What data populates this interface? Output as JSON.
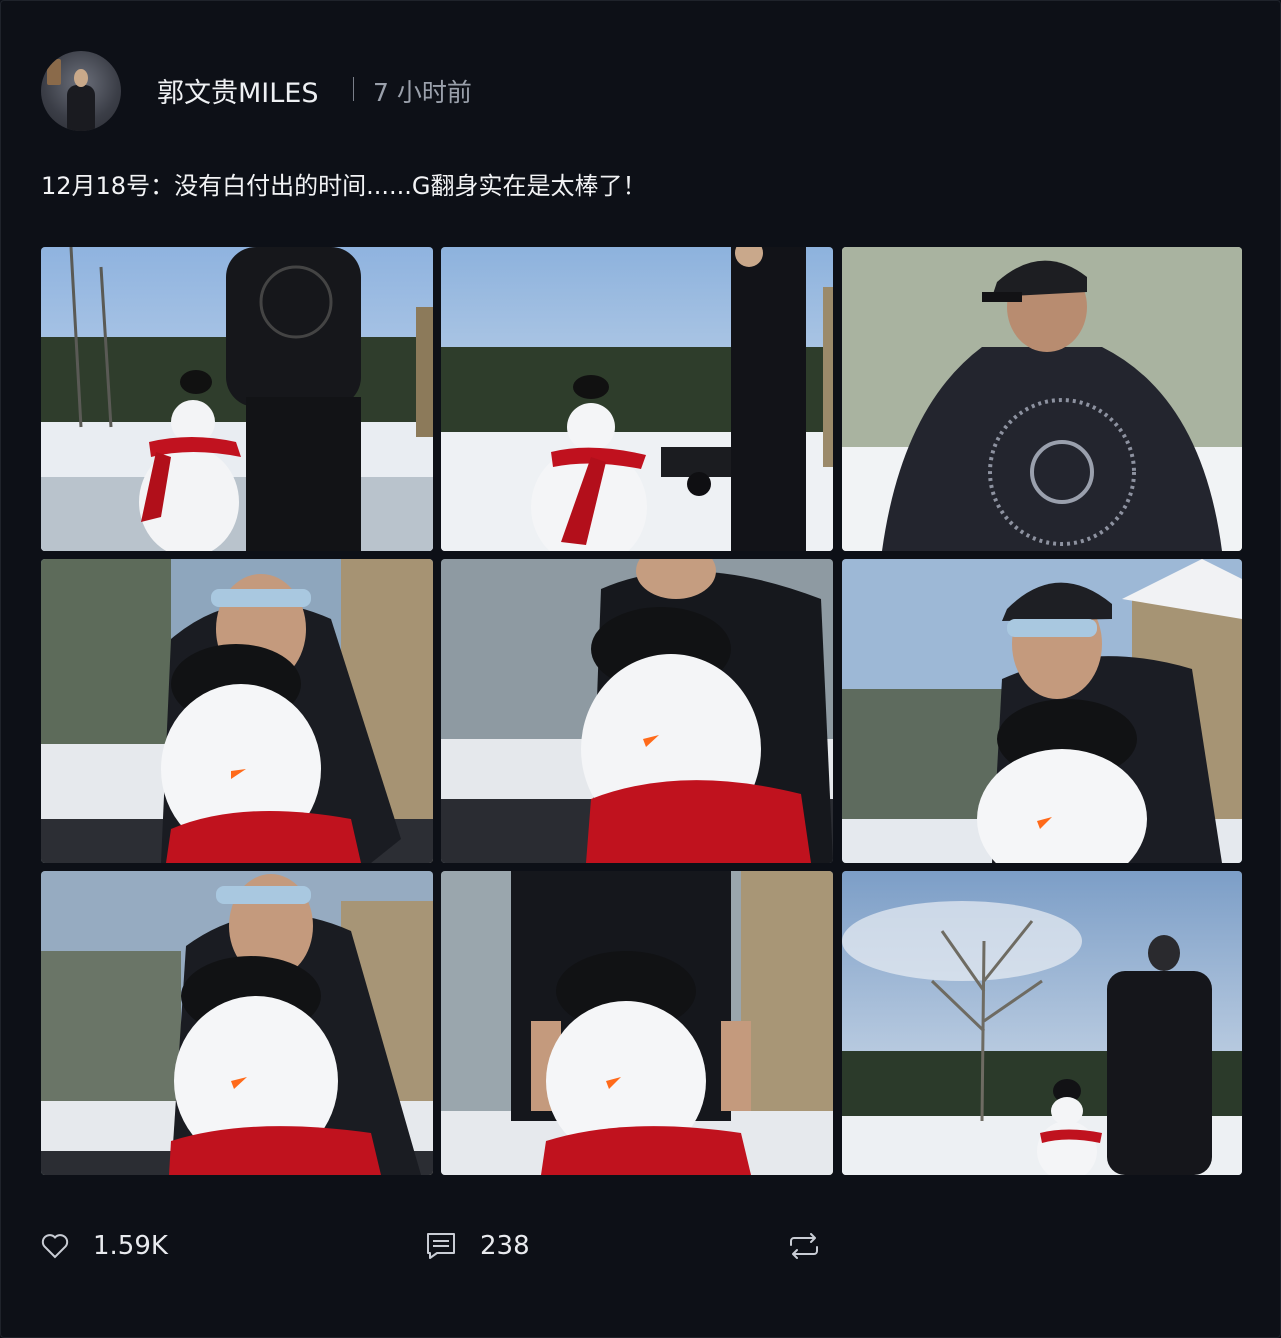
{
  "post": {
    "username": "郭文贵MILES",
    "time": "7 小时前",
    "text": "12月18号：没有白付出的时间......G翻身实在是太棒了！"
  },
  "photos": [
    {
      "name": "photo-1",
      "alt": "snowman-man-back-view"
    },
    {
      "name": "photo-2",
      "alt": "snowman-man-side"
    },
    {
      "name": "photo-3",
      "alt": "man-jacket-back"
    },
    {
      "name": "photo-4",
      "alt": "man-with-snowman-1"
    },
    {
      "name": "photo-5",
      "alt": "man-with-snowman-2"
    },
    {
      "name": "photo-6",
      "alt": "man-with-snowman-cap"
    },
    {
      "name": "photo-7",
      "alt": "man-with-snowman-3"
    },
    {
      "name": "photo-8",
      "alt": "man-behind-snowman"
    },
    {
      "name": "photo-9",
      "alt": "snowman-man-tree"
    }
  ],
  "actions": {
    "like_count": "1.59K",
    "comment_count": "238",
    "like_icon": "heart-icon",
    "comment_icon": "comment-icon",
    "repost_icon": "repost-icon"
  }
}
